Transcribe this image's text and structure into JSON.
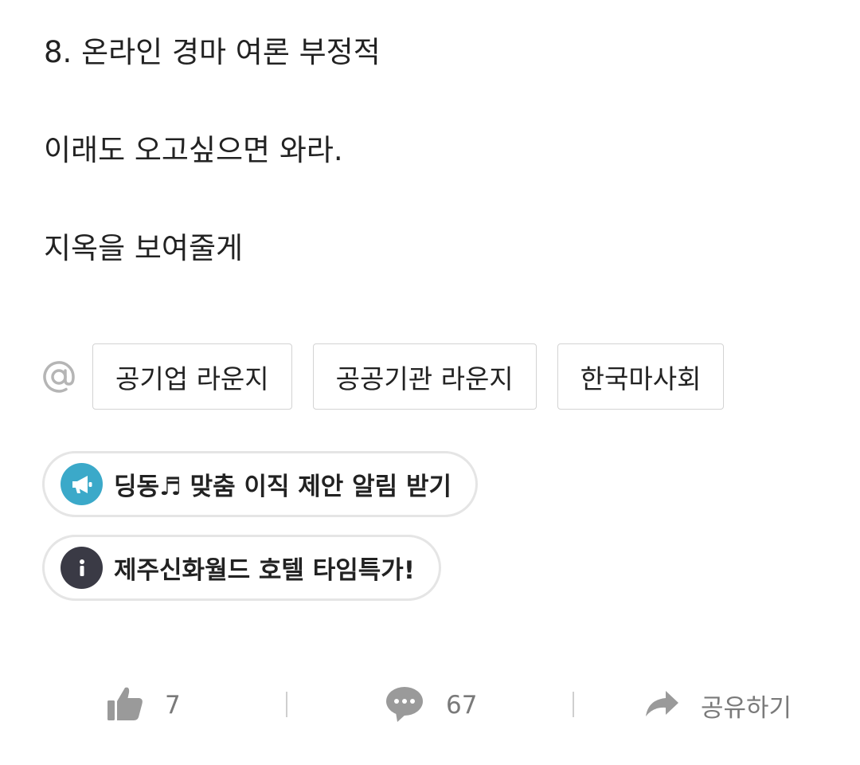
{
  "post": {
    "paragraphs": [
      "8. 온라인 경마 여론 부정적",
      "이래도 오고싶으면 와라.",
      "지옥을 보여줄게"
    ]
  },
  "tags": {
    "icon": "at-icon",
    "items": [
      "공기업 라운지",
      "공공기관 라운지",
      "한국마사회"
    ]
  },
  "promos": [
    {
      "icon": "megaphone-icon",
      "icon_color": "#3ba9c9",
      "label": "딩동♬ 맞춤 이직 제안 알림 받기"
    },
    {
      "icon": "info-icon",
      "icon_color": "#3a3a45",
      "label": "제주신화월드 호텔 타임특가!"
    }
  ],
  "actions": {
    "like": {
      "icon": "thumbs-up-icon",
      "count": "7"
    },
    "comment": {
      "icon": "comment-bubble-icon",
      "count": "67"
    },
    "share": {
      "icon": "share-arrow-icon",
      "label": "공유하기"
    }
  },
  "colors": {
    "text": "#222222",
    "muted": "#7a7a7a",
    "icon_gray": "#9a9a9a",
    "border": "#d3d3d3"
  }
}
